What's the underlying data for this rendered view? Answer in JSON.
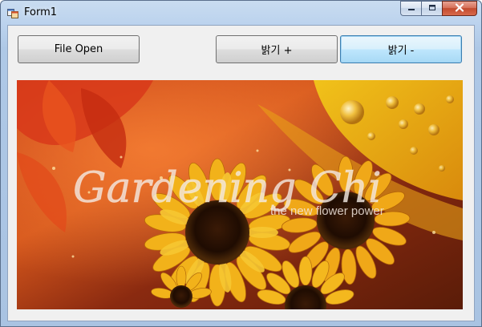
{
  "window": {
    "title": "Form1"
  },
  "toolbar": {
    "file_open_label": "File Open",
    "brightness_up_label": "밝기 +",
    "brightness_down_label": "밝기 -"
  },
  "picture": {
    "logo_text": "Gardening Chi",
    "tagline": "the new flower power"
  },
  "icons": {
    "app": "form-app-icon",
    "minimize": "minimize-icon",
    "maximize": "maximize-icon",
    "close": "close-icon"
  },
  "colors": {
    "focus_border": "#3c7fb1",
    "close_button": "#c24a2e"
  }
}
